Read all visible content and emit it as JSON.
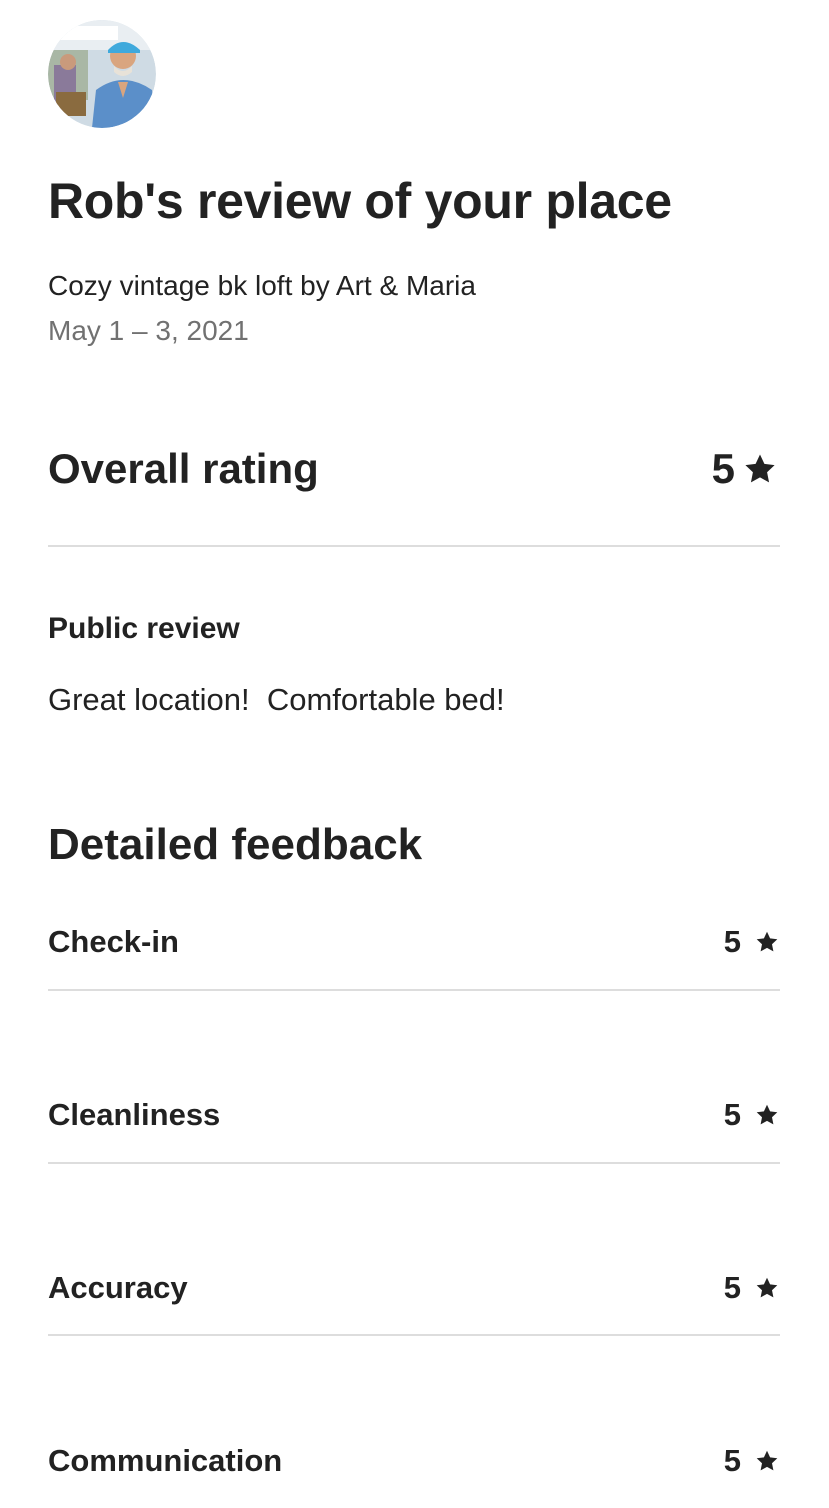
{
  "review": {
    "title": "Rob's review of your place",
    "listing": "Cozy vintage bk loft by Art & Maria",
    "dates": "May 1 – 3, 2021"
  },
  "overall": {
    "label": "Overall rating",
    "value": "5",
    "icon": "star-icon"
  },
  "public_review": {
    "title": "Public review",
    "text": "Great location!  Comfortable bed!"
  },
  "detailed": {
    "title": "Detailed feedback",
    "items": [
      {
        "label": "Check-in",
        "value": "5"
      },
      {
        "label": "Cleanliness",
        "value": "5"
      },
      {
        "label": "Accuracy",
        "value": "5"
      },
      {
        "label": "Communication",
        "value": "5"
      }
    ]
  },
  "colors": {
    "text": "#222222",
    "secondary": "#717171",
    "divider": "#dddddd",
    "avatar_shirt": "#5b8fc9",
    "avatar_cap": "#3fa9dc"
  }
}
